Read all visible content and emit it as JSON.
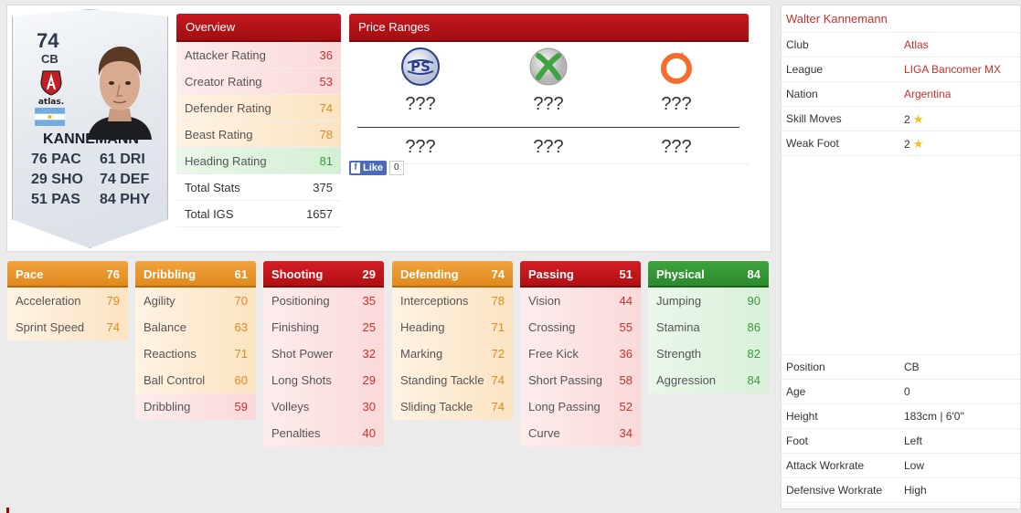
{
  "card": {
    "rating": "74",
    "position": "CB",
    "club_logo": "atlas",
    "flag": "Argentina flag",
    "name": "KANNEMANN",
    "stats": [
      [
        "76 PAC",
        "61 DRI"
      ],
      [
        "29 SHO",
        "74 DEF"
      ],
      [
        "51 PAS",
        "84 PHY"
      ]
    ]
  },
  "overview": {
    "title": "Overview",
    "rows": [
      {
        "label": "Attacker Rating",
        "value": "36",
        "tone": "red"
      },
      {
        "label": "Creator Rating",
        "value": "53",
        "tone": "red"
      },
      {
        "label": "Defender Rating",
        "value": "74",
        "tone": "orange"
      },
      {
        "label": "Beast Rating",
        "value": "78",
        "tone": "orange"
      },
      {
        "label": "Heading Rating",
        "value": "81",
        "tone": "green"
      },
      {
        "label": "Total Stats",
        "value": "375",
        "tone": "grey"
      },
      {
        "label": "Total IGS",
        "value": "1657",
        "tone": "grey"
      }
    ]
  },
  "price": {
    "title": "Price Ranges",
    "platforms": [
      {
        "icon": "playstation-network-icon",
        "top": "???",
        "bottom": "???"
      },
      {
        "icon": "xbox-icon",
        "top": "???",
        "bottom": "???"
      },
      {
        "icon": "origin-icon",
        "top": "???",
        "bottom": "???"
      }
    ]
  },
  "like": {
    "label": "Like",
    "count": "0"
  },
  "attributes": [
    {
      "name": "Pace",
      "value": "76",
      "tone": "orange",
      "rows": [
        {
          "label": "Acceleration",
          "value": "79"
        },
        {
          "label": "Sprint Speed",
          "value": "74"
        }
      ]
    },
    {
      "name": "Dribbling",
      "value": "61",
      "tone": "orange",
      "rows": [
        {
          "label": "Agility",
          "value": "70"
        },
        {
          "label": "Balance",
          "value": "63"
        },
        {
          "label": "Reactions",
          "value": "71"
        },
        {
          "label": "Ball Control",
          "value": "60"
        },
        {
          "label": "Dribbling",
          "value": "59"
        }
      ]
    },
    {
      "name": "Shooting",
      "value": "29",
      "tone": "red",
      "rows": [
        {
          "label": "Positioning",
          "value": "35"
        },
        {
          "label": "Finishing",
          "value": "25"
        },
        {
          "label": "Shot Power",
          "value": "32"
        },
        {
          "label": "Long Shots",
          "value": "29"
        },
        {
          "label": "Volleys",
          "value": "30"
        },
        {
          "label": "Penalties",
          "value": "40"
        }
      ]
    },
    {
      "name": "Defending",
      "value": "74",
      "tone": "orange",
      "rows": [
        {
          "label": "Interceptions",
          "value": "78"
        },
        {
          "label": "Heading",
          "value": "71"
        },
        {
          "label": "Marking",
          "value": "72"
        },
        {
          "label": "Standing Tackle",
          "value": "74"
        },
        {
          "label": "Sliding Tackle",
          "value": "74"
        }
      ]
    },
    {
      "name": "Passing",
      "value": "51",
      "tone": "red",
      "rows": [
        {
          "label": "Vision",
          "value": "44"
        },
        {
          "label": "Crossing",
          "value": "55"
        },
        {
          "label": "Free Kick",
          "value": "36"
        },
        {
          "label": "Short Passing",
          "value": "58"
        },
        {
          "label": "Long Passing",
          "value": "52"
        },
        {
          "label": "Curve",
          "value": "34"
        }
      ]
    },
    {
      "name": "Physical",
      "value": "84",
      "tone": "green",
      "rows": [
        {
          "label": "Jumping",
          "value": "90"
        },
        {
          "label": "Stamina",
          "value": "86"
        },
        {
          "label": "Strength",
          "value": "82"
        },
        {
          "label": "Aggression",
          "value": "84"
        }
      ]
    }
  ],
  "info": {
    "player_name": "Walter Kannemann",
    "top_rows": [
      {
        "key": "Club",
        "value": "Atlas",
        "link": true
      },
      {
        "key": "League",
        "value": "LIGA Bancomer MX",
        "link": true
      },
      {
        "key": "Nation",
        "value": "Argentina",
        "link": true
      },
      {
        "key": "Skill Moves",
        "value": "2",
        "star": true
      },
      {
        "key": "Weak Foot",
        "value": "2",
        "star": true
      }
    ],
    "bottom_rows": [
      {
        "key": "Position",
        "value": "CB"
      },
      {
        "key": "Age",
        "value": "0"
      },
      {
        "key": "Height",
        "value": "183cm | 6'0\""
      },
      {
        "key": "Foot",
        "value": "Left"
      },
      {
        "key": "Attack Workrate",
        "value": "Low"
      },
      {
        "key": "Defensive Workrate",
        "value": "High"
      }
    ]
  }
}
